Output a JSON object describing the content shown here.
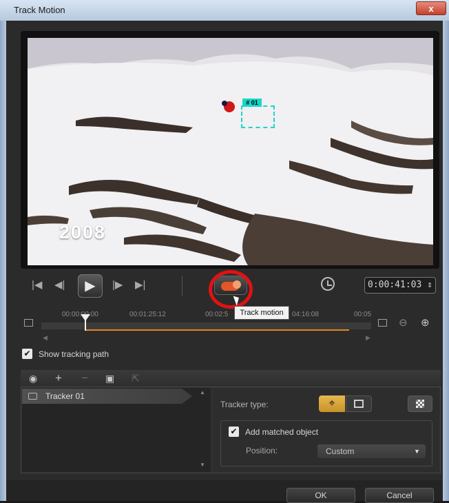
{
  "window": {
    "title": "Track Motion",
    "close_label": "x"
  },
  "preview": {
    "year_overlay": "2008",
    "tracker_label": "# 01"
  },
  "transport": {
    "go_start_icon": "skip-to-start-icon",
    "prev_frame_icon": "previous-frame-icon",
    "play_icon": "play-icon",
    "next_frame_icon": "next-frame-icon",
    "go_end_icon": "skip-to-end-icon",
    "track_motion_tooltip": "Track motion",
    "timecode": "0:00:41:03"
  },
  "timeline": {
    "ticks": [
      "00:00:00:00",
      "00:01:25:12",
      "00:02:5",
      "04:16:08",
      "00:05"
    ],
    "progress_color": "#e0891a",
    "playhead_position_fraction": 0.13
  },
  "options": {
    "show_tracking_path_label": "Show tracking path",
    "show_tracking_path_checked": true
  },
  "tracker_toolbar": {
    "tools": [
      "tracker-icon",
      "plus-icon",
      "minus-icon",
      "rename-icon",
      "export-icon"
    ]
  },
  "trackers": [
    {
      "name": "Tracker 01"
    }
  ],
  "properties": {
    "tracker_type_label": "Tracker type:",
    "tracker_type_selected": "point",
    "add_matched_object_label": "Add matched object",
    "add_matched_object_checked": true,
    "position_label": "Position:",
    "position_value": "Custom"
  },
  "footer": {
    "ok_label": "OK",
    "cancel_label": "Cancel"
  },
  "colors": {
    "accent_orange": "#e0891a",
    "tracker_cyan": "#19d6c8",
    "highlight_red": "#e01212",
    "type_button_gold": "#e6b84e"
  }
}
